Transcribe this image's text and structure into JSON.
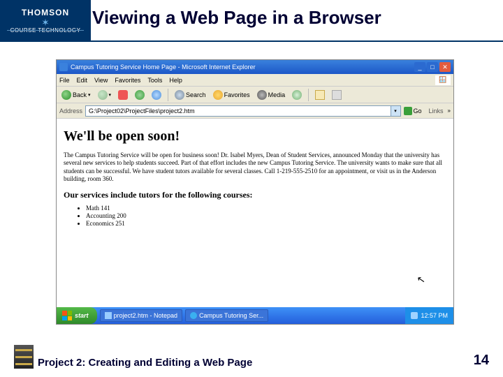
{
  "slide": {
    "logo_top": "THOMSON",
    "logo_bottom": "COURSE TECHNOLOGY",
    "title": "Viewing a Web Page in a Browser",
    "footer_text": "Project 2: Creating and Editing a Web Page",
    "page_number": "14"
  },
  "browser": {
    "window_title": "Campus Tutoring Service Home Page - Microsoft Internet Explorer",
    "menus": {
      "file": "File",
      "edit": "Edit",
      "view": "View",
      "favorites": "Favorites",
      "tools": "Tools",
      "help": "Help"
    },
    "toolbar": {
      "back": "Back",
      "search": "Search",
      "favorites": "Favorites",
      "media": "Media"
    },
    "address": {
      "label": "Address",
      "value": "G:\\Project02\\ProjectFiles\\project2.htm",
      "go": "Go",
      "links": "Links"
    }
  },
  "page": {
    "h1": "We'll be open soon!",
    "p": "The Campus Tutoring Service will be open for business soon! Dr. Isabel Myers, Dean of Student Services, announced Monday that the university has several new services to help students succeed. Part of that effort includes the new Campus Tutoring Service. The university wants to make sure that all students can be successful. We have student tutors available for several classes. Call 1-219-555-2510 for an appointment, or visit us in the Anderson building, room 360.",
    "h2": "Our services include tutors for the following courses:",
    "li1": "Math 141",
    "li2": "Accounting 200",
    "li3": "Economics 251"
  },
  "taskbar": {
    "start": "start",
    "task1": "project2.htm - Notepad",
    "task2": "Campus Tutoring Ser...",
    "time": "12:57 PM"
  }
}
